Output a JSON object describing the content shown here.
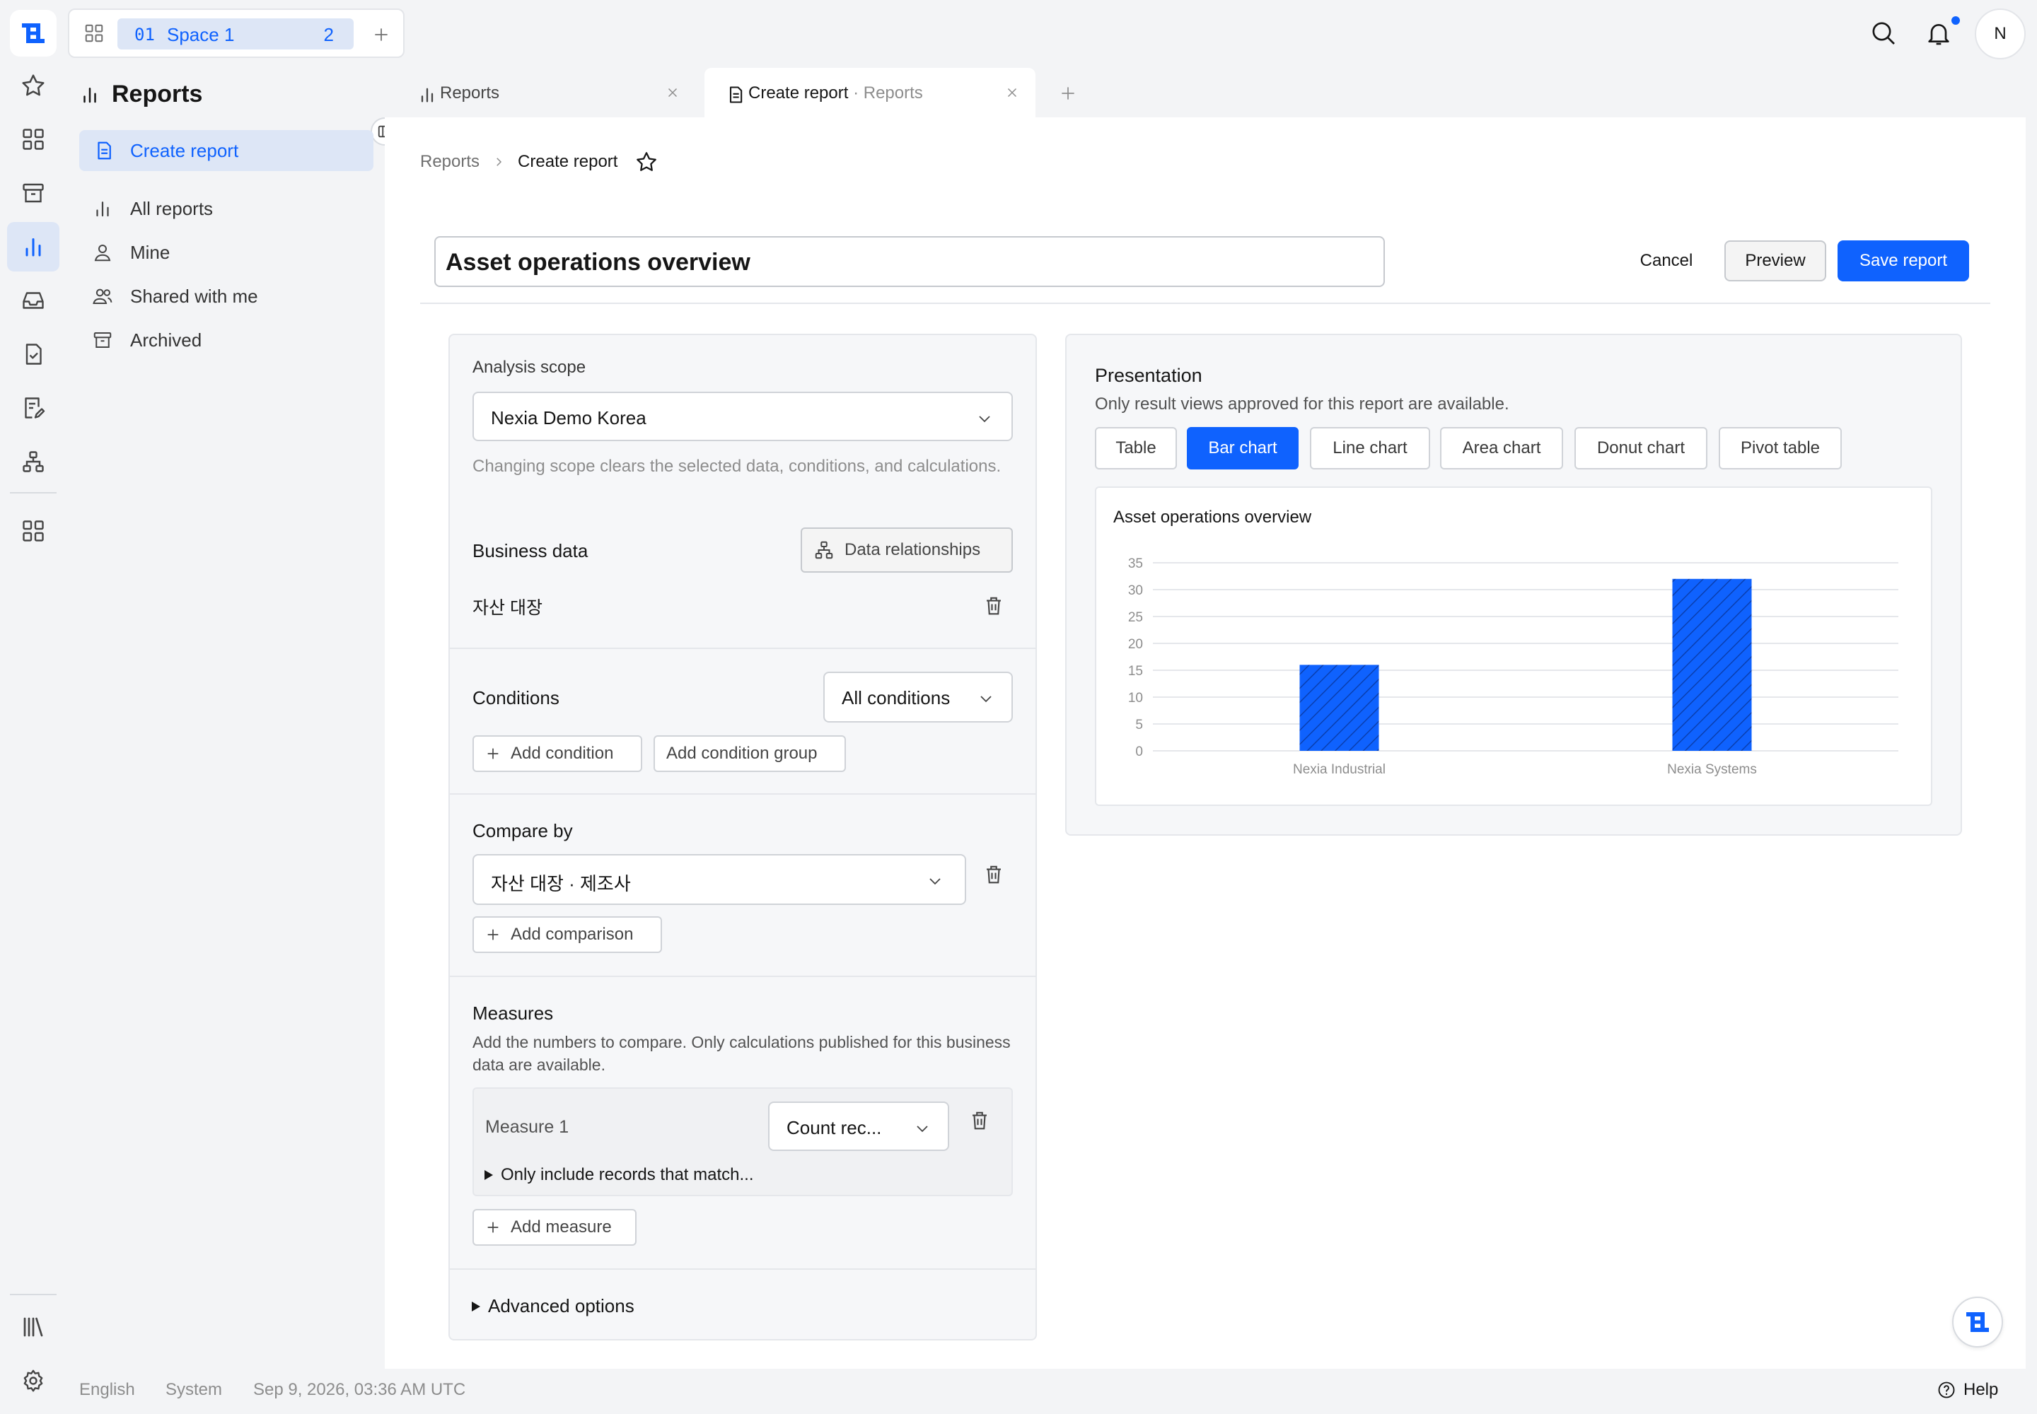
{
  "colors": {
    "accent": "#0f62fe",
    "accent_soft": "#dde6f6"
  },
  "space": {
    "number": "01",
    "name": "Space 1",
    "count": "2"
  },
  "nav": {
    "title": "Reports",
    "active_item": "Create report",
    "items": [
      "All reports",
      "Mine",
      "Shared with me",
      "Archived"
    ]
  },
  "tabs": [
    {
      "label": "Reports",
      "sub": ""
    },
    {
      "label": "Create report",
      "sub": "· Reports"
    }
  ],
  "breadcrumb": {
    "parent": "Reports",
    "current": "Create report"
  },
  "report": {
    "title": "Asset operations overview"
  },
  "actions": {
    "cancel": "Cancel",
    "preview": "Preview",
    "save": "Save report"
  },
  "builder": {
    "scope_label": "Analysis scope",
    "scope_value": "Nexia Demo Korea",
    "scope_help": "Changing scope clears the selected data, conditions, and calculations.",
    "business_label": "Business data",
    "relationships_button": "Data relationships",
    "business_item": "자산 대장",
    "conditions_label": "Conditions",
    "conditions_value": "All conditions",
    "add_condition": "Add condition",
    "add_condition_group": "Add condition group",
    "compare_label": "Compare by",
    "compare_value": "자산 대장 · 제조사",
    "add_comparison": "Add comparison",
    "measures_label": "Measures",
    "measures_help": "Add the numbers to compare. Only calculations published for this business data are available.",
    "measure_name": "Measure 1",
    "measure_value": "Count rec...",
    "measure_filter": "Only include records that match...",
    "add_measure": "Add measure",
    "advanced": "Advanced options"
  },
  "presentation": {
    "title": "Presentation",
    "help": "Only result views approved for this report are available.",
    "options": [
      "Table",
      "Bar chart",
      "Line chart",
      "Area chart",
      "Donut chart",
      "Pivot table"
    ],
    "selected": "Bar chart"
  },
  "chart_data": {
    "type": "bar",
    "title": "Asset operations overview",
    "categories": [
      "Nexia Industrial",
      "Nexia Systems"
    ],
    "values": [
      16,
      32
    ],
    "ylim": [
      0,
      35
    ],
    "yticks": [
      0,
      5,
      10,
      15,
      20,
      25,
      30,
      35
    ],
    "grid": true,
    "bar_color": "#0f62fe",
    "bar_pattern": "diagonal-hatch"
  },
  "footer": {
    "language": "English",
    "theme": "System",
    "datetime": "Sep 9, 2026, 03:36 AM UTC",
    "help": "Help"
  }
}
